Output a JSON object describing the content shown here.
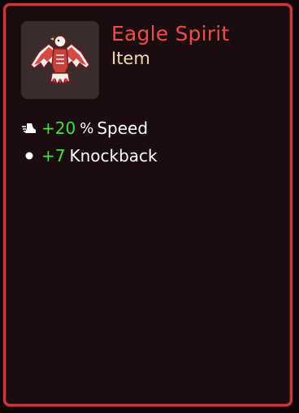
{
  "item": {
    "name": "Eagle Spirit",
    "type": "Item",
    "icon": "eagle-spirit-icon"
  },
  "stats": [
    {
      "icon": "speed-icon",
      "value": "+20",
      "unit": "%",
      "label": "Speed"
    },
    {
      "icon": "knockback-icon",
      "value": "+7",
      "label": "Knockback"
    }
  ],
  "colors": {
    "title": "#f04a47",
    "subtitle": "#eadbb0",
    "positive_value": "#3fe33a",
    "border": "#c7373d",
    "panel": "#1b0d0f"
  }
}
